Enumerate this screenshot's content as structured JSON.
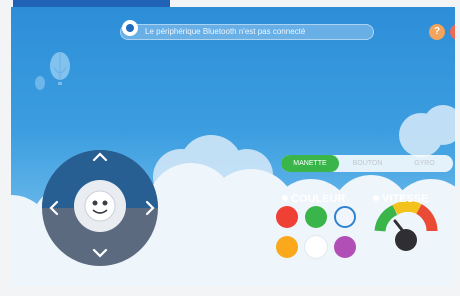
{
  "status": {
    "message": "Le périphérique Bluetooth n'est pas connecté",
    "icon": "robot-icon"
  },
  "header": {
    "help_label": "?",
    "bluetooth_label": "ʙ"
  },
  "mode_tabs": [
    {
      "label": "MANETTE",
      "active": true
    },
    {
      "label": "BOUTON",
      "active": false
    },
    {
      "label": "GYRO",
      "active": false
    }
  ],
  "color_section": {
    "label": "COULEUR",
    "swatches": [
      {
        "name": "red",
        "color": "#ef4035"
      },
      {
        "name": "green",
        "color": "#3ab54a"
      },
      {
        "name": "blue",
        "color": "#2f83d0"
      },
      {
        "name": "orange",
        "color": "#f9a91b"
      },
      {
        "name": "white",
        "color": "#ffffff"
      },
      {
        "name": "purple",
        "color": "#b14fb7"
      }
    ]
  },
  "speed_section": {
    "label": "VITESSE"
  },
  "colors": {
    "background_top": "#2d8ed8",
    "accent_green": "#39b54a",
    "dpad": "#5b6a7f"
  }
}
